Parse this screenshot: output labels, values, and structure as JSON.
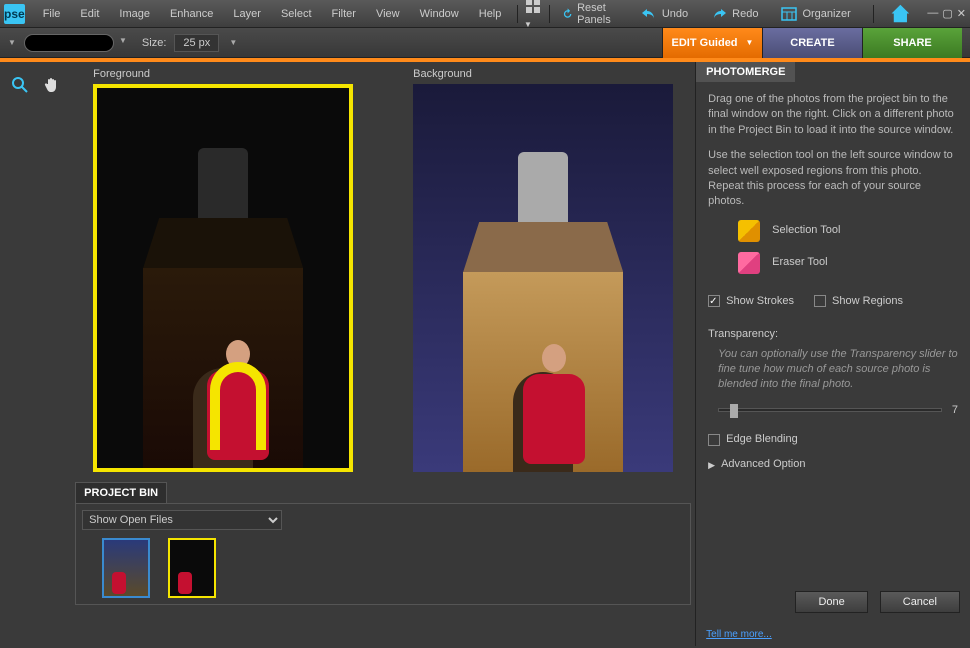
{
  "app": {
    "logo": "pse"
  },
  "menu": [
    "File",
    "Edit",
    "Image",
    "Enhance",
    "Layer",
    "Select",
    "Filter",
    "View",
    "Window",
    "Help"
  ],
  "top_actions": {
    "reset": "Reset Panels",
    "undo": "Undo",
    "redo": "Redo",
    "organizer": "Organizer"
  },
  "options": {
    "size_label": "Size:",
    "size_value": "25 px"
  },
  "modes": {
    "edit": "EDIT Guided",
    "create": "CREATE",
    "share": "SHARE"
  },
  "workspace": {
    "foreground_label": "Foreground",
    "background_label": "Background"
  },
  "project_bin": {
    "title": "PROJECT BIN",
    "dropdown": "Show Open Files"
  },
  "panel": {
    "tab": "PHOTOMERGE",
    "help1": "Drag one of the photos from the project bin to the final window on the right. Click on a different photo in the Project Bin to load it into the source window.",
    "help2": "Use the selection tool on the left source window to select well exposed regions from this photo. Repeat this process for each of your source photos.",
    "selection_tool": "Selection Tool",
    "eraser_tool": "Eraser Tool",
    "show_strokes": "Show Strokes",
    "show_regions": "Show Regions",
    "transparency_label": "Transparency:",
    "transparency_help": "You can optionally use the Transparency slider to fine tune how much of each source photo is blended into the final photo.",
    "transparency_value": "7",
    "edge_blending": "Edge Blending",
    "advanced": "Advanced Option",
    "done": "Done",
    "cancel": "Cancel",
    "tellmore": "Tell me more..."
  }
}
